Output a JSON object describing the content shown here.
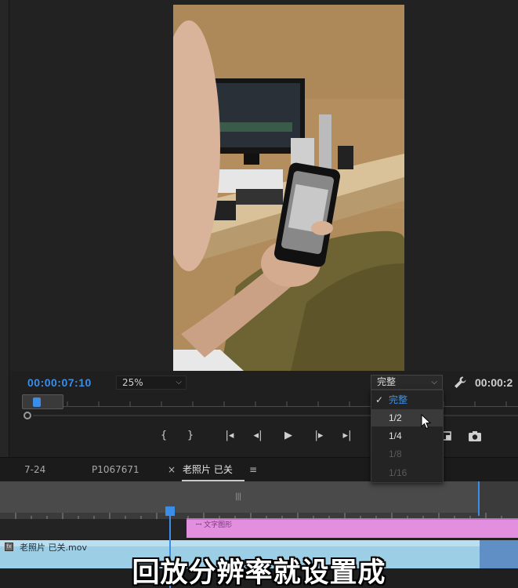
{
  "monitor": {
    "timecode": "00:00:07:10",
    "zoom_level": "25%",
    "resolution_selected": "完整",
    "right_timecode": "00:00:2"
  },
  "resolution_menu": {
    "items": [
      {
        "label": "完整",
        "state": "selected"
      },
      {
        "label": "1/2",
        "state": "hover"
      },
      {
        "label": "1/4",
        "state": "enabled"
      },
      {
        "label": "1/8",
        "state": "disabled"
      },
      {
        "label": "1/16",
        "state": "disabled"
      }
    ],
    "check_mark": "✓"
  },
  "transport": {
    "mark_in": "{",
    "mark_out": "}",
    "go_to_in": "|◂",
    "step_back": "◂|",
    "play": "▶",
    "step_forward": "|▸",
    "go_to_out": "▸|"
  },
  "tabs": {
    "items": [
      "7-24",
      "P1067671",
      "老照片 已关"
    ],
    "close_glyph": "×",
    "menu_glyph": "≡",
    "active_index": 2
  },
  "timeline": {
    "clip_v1_name": "老照片 已关.mov",
    "clip_fx_badge": "fx",
    "clip_v2_label": "ꟷ 文字图形"
  },
  "subtitle": "回放分辨率就设置成",
  "colors": {
    "accent_blue": "#3b8ee8",
    "pink_clip": "#e38fe0",
    "blue_clip": "#9ccfe6"
  }
}
